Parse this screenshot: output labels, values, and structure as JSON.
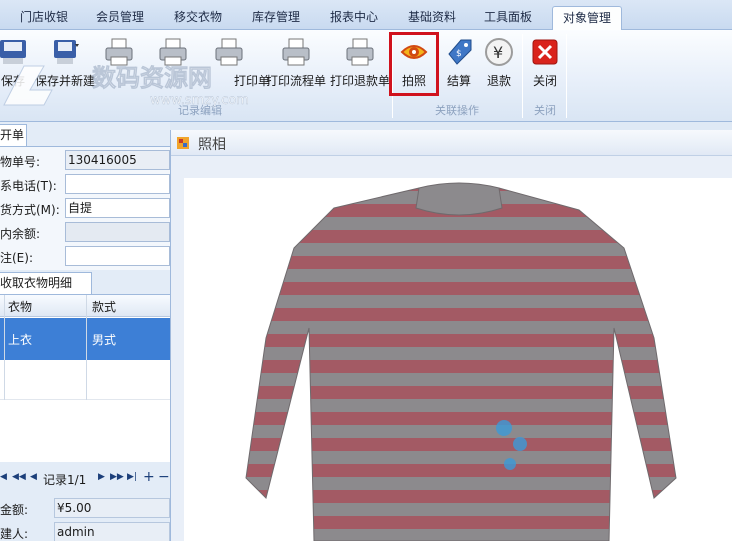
{
  "menu_tabs": [
    "门店收银",
    "会员管理",
    "移交衣物",
    "库存管理",
    "报表中心",
    "基础资料",
    "工具面板",
    "对象管理"
  ],
  "ribbon": {
    "buttons": {
      "save": "保存",
      "save_new": "保存并新建",
      "print_a": "打印单",
      "print_flow": "打印流程单",
      "print_refund": "打印退款单",
      "photo": "拍照",
      "settle": "结算",
      "refund": "退款",
      "close": "关闭"
    },
    "groups": {
      "records": "记录编辑",
      "related": "关联操作",
      "close": "关闭"
    },
    "watermark": "数码资源网 www.smzy.com"
  },
  "left_panel": {
    "tab": "开单",
    "fields": [
      {
        "label": "衣物单号:",
        "value": "130416005"
      },
      {
        "label": "联系电话(T):",
        "value": ""
      },
      {
        "label": "取货方式(M):",
        "value": "自提"
      },
      {
        "label": "卡内余额:",
        "value": ""
      },
      {
        "label": "备注(E):",
        "value": ""
      }
    ],
    "subtab": "收取衣物明细",
    "grid": {
      "columns": [
        "衣物",
        "款式"
      ],
      "rows": [
        {
          "item": "上衣",
          "style": "男式"
        }
      ]
    },
    "nav": {
      "record": "记录1/1"
    },
    "totals": [
      {
        "label": "总金额:",
        "value": "¥5.00"
      },
      {
        "label": "创建人:",
        "value": "admin"
      }
    ]
  },
  "photo_window": {
    "title": "照相"
  },
  "colors": {
    "accent": "#3d7fd6",
    "highlight": "#d0121d",
    "sweater_red": "#a35a64",
    "sweater_gray": "#8c8a8d"
  }
}
